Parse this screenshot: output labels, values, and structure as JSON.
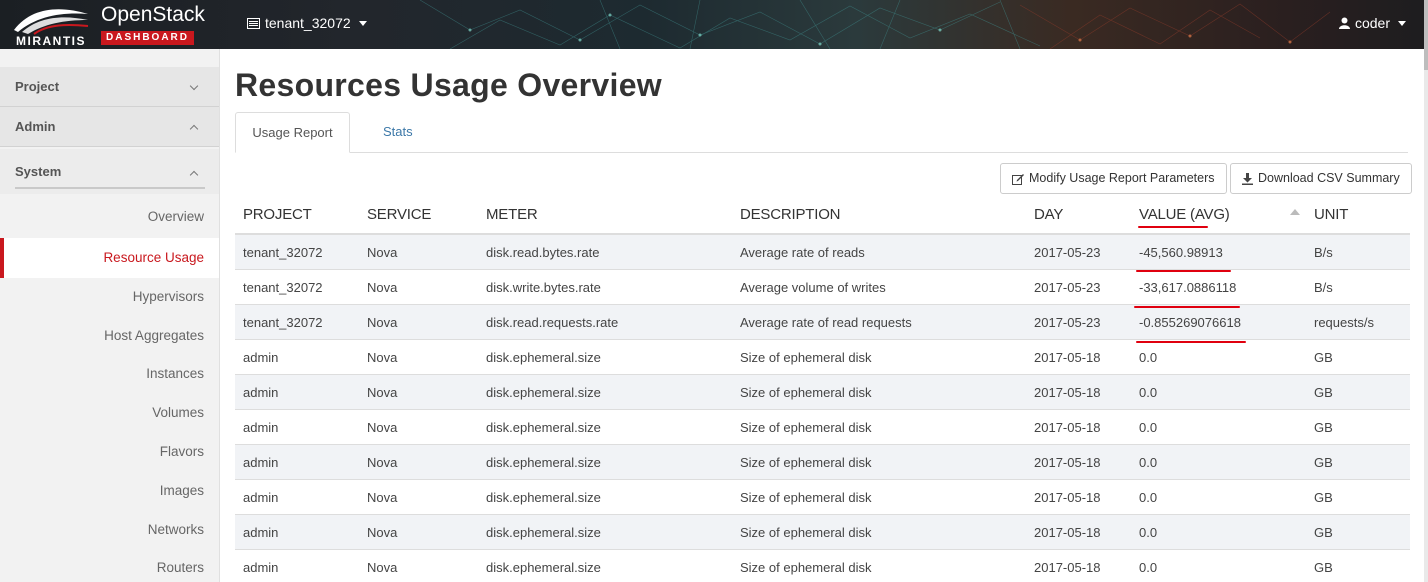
{
  "header": {
    "brand_company": "MIRANTIS",
    "brand_product": "OpenStack",
    "brand_sub": "DASHBOARD",
    "tenant": "tenant_32072",
    "user": "coder"
  },
  "sidebar": {
    "sections": [
      {
        "label": "Project",
        "expanded": false
      },
      {
        "label": "Admin",
        "expanded": true
      }
    ],
    "system_label": "System",
    "items": [
      {
        "label": "Overview",
        "active": false
      },
      {
        "label": "Resource Usage",
        "active": true
      },
      {
        "label": "Hypervisors",
        "active": false
      },
      {
        "label": "Host Aggregates",
        "active": false
      },
      {
        "label": "Instances",
        "active": false
      },
      {
        "label": "Volumes",
        "active": false
      },
      {
        "label": "Flavors",
        "active": false
      },
      {
        "label": "Images",
        "active": false
      },
      {
        "label": "Networks",
        "active": false
      },
      {
        "label": "Routers",
        "active": false
      }
    ]
  },
  "main": {
    "title": "Resources Usage Overview",
    "tabs": [
      {
        "label": "Usage Report",
        "active": true
      },
      {
        "label": "Stats",
        "active": false
      }
    ],
    "buttons": {
      "modify": "Modify Usage Report Parameters",
      "download": "Download CSV Summary"
    },
    "table": {
      "columns": [
        "PROJECT",
        "SERVICE",
        "METER",
        "DESCRIPTION",
        "DAY",
        "VALUE (AVG)",
        "UNIT"
      ],
      "sorted_column": "VALUE (AVG)",
      "rows": [
        [
          "tenant_32072",
          "Nova",
          "disk.read.bytes.rate",
          "Average rate of reads",
          "2017-05-23",
          "-45,560.98913",
          "B/s"
        ],
        [
          "tenant_32072",
          "Nova",
          "disk.write.bytes.rate",
          "Average volume of writes",
          "2017-05-23",
          "-33,617.0886118",
          "B/s"
        ],
        [
          "tenant_32072",
          "Nova",
          "disk.read.requests.rate",
          "Average rate of read requests",
          "2017-05-23",
          "-0.855269076618",
          "requests/s"
        ],
        [
          "admin",
          "Nova",
          "disk.ephemeral.size",
          "Size of ephemeral disk",
          "2017-05-18",
          "0.0",
          "GB"
        ],
        [
          "admin",
          "Nova",
          "disk.ephemeral.size",
          "Size of ephemeral disk",
          "2017-05-18",
          "0.0",
          "GB"
        ],
        [
          "admin",
          "Nova",
          "disk.ephemeral.size",
          "Size of ephemeral disk",
          "2017-05-18",
          "0.0",
          "GB"
        ],
        [
          "admin",
          "Nova",
          "disk.ephemeral.size",
          "Size of ephemeral disk",
          "2017-05-18",
          "0.0",
          "GB"
        ],
        [
          "admin",
          "Nova",
          "disk.ephemeral.size",
          "Size of ephemeral disk",
          "2017-05-18",
          "0.0",
          "GB"
        ],
        [
          "admin",
          "Nova",
          "disk.ephemeral.size",
          "Size of ephemeral disk",
          "2017-05-18",
          "0.0",
          "GB"
        ],
        [
          "admin",
          "Nova",
          "disk.ephemeral.size",
          "Size of ephemeral disk",
          "2017-05-18",
          "0.0",
          "GB"
        ]
      ]
    }
  },
  "colors": {
    "accent": "#c9181e",
    "link": "#3c78a8",
    "annotation": "#e0000f"
  }
}
